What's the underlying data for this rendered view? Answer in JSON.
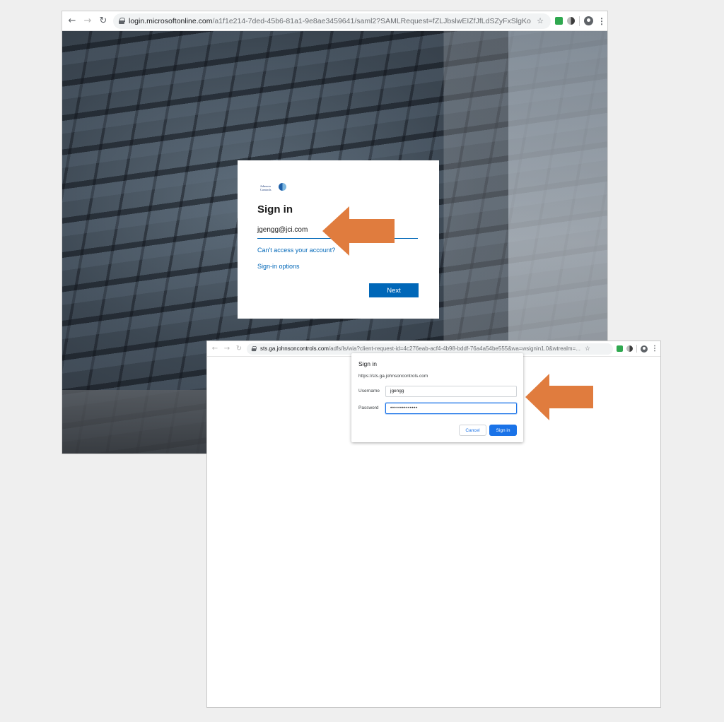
{
  "colors": {
    "arrow": "#e07c3e",
    "ms_blue": "#0067b8",
    "chrome_blue": "#1a73e8"
  },
  "window1": {
    "url_host": "login.microsoftonline.com",
    "url_rest": "/a1f1e214-7ded-45b6-81a1-9e8ae3459641/saml2?SAMLRequest=fZLJbslwEIZfJfLdSZyFxSlgKoSK1CU...",
    "card": {
      "logo_text_1": "Johnson",
      "logo_text_2": "Controls",
      "title": "Sign in",
      "email_value": "jgengg@jci.com",
      "link_cant_access": "Can't access your account?",
      "link_signin_options": "Sign-in options",
      "next_label": "Next"
    }
  },
  "window2": {
    "url_host": "sts.ga.johnsoncontrols.com",
    "url_rest": "/adfs/ls/wia?client-request-id=4c276eab-acf4-4b98-bddf-76a4a54be555&wa=wsignin1.0&wtrealm=...",
    "dialog": {
      "title": "Sign in",
      "host": "https://sts.ga.johnsoncontrols.com",
      "username_label": "Username",
      "username_value": "jgengg",
      "password_label": "Password",
      "password_value": "••••••••••••••",
      "cancel_label": "Cancel",
      "signin_label": "Sign in"
    }
  },
  "icons": {
    "back": "←",
    "forward": "→",
    "reload": "↻",
    "star": "☆",
    "menu": "⋮"
  }
}
